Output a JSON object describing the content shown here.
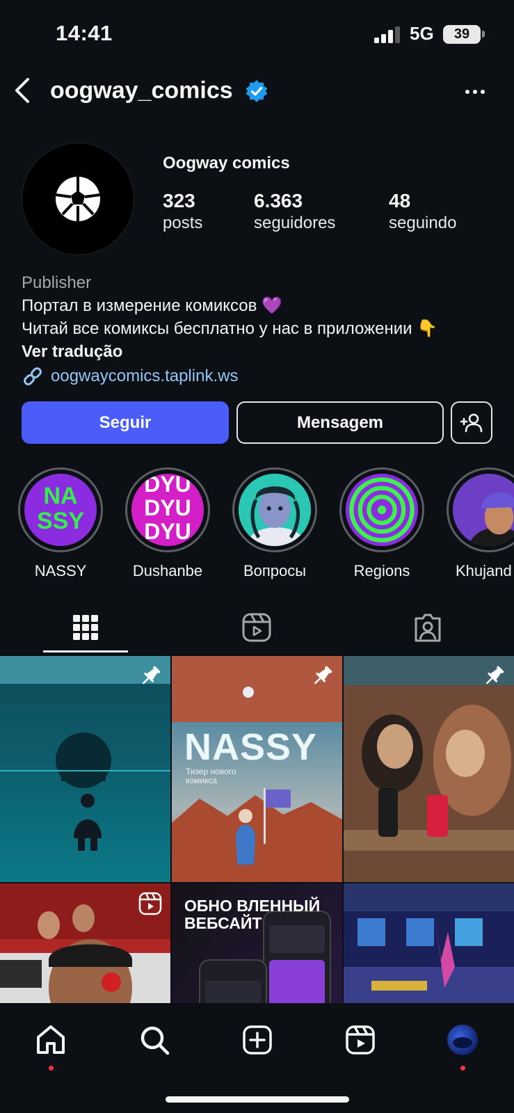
{
  "status_bar": {
    "time": "14:41",
    "network": "5G",
    "battery": "39"
  },
  "header": {
    "username": "oogway_comics"
  },
  "profile": {
    "display_name": "Oogway comics",
    "stats": [
      {
        "value": "323",
        "label": "posts"
      },
      {
        "value": "6.363",
        "label": "seguidores"
      },
      {
        "value": "48",
        "label": "seguindo"
      }
    ],
    "category": "Publisher",
    "bio_lines": [
      "Портал в измерение комиксов 💜",
      "Читай все комиксы бесплатно у нас в приложении 👇"
    ],
    "translate": "Ver tradução",
    "link": "oogwaycomics.taplink.ws"
  },
  "actions": {
    "follow": "Seguir",
    "message": "Mensagem"
  },
  "highlights": [
    {
      "label": "NASSY",
      "art_text": "NA SSY"
    },
    {
      "label": "Dushanbe",
      "art_text": "DYU DYU DYU"
    },
    {
      "label": "Вопросы"
    },
    {
      "label": "Regions"
    },
    {
      "label": "Khujand"
    }
  ],
  "posts": [
    {
      "type": "pinned"
    },
    {
      "type": "pinned",
      "art_title": "NASSY",
      "art_subtitle": "Тизер нового комикса"
    },
    {
      "type": "pinned"
    },
    {
      "type": "reel"
    },
    {
      "type": "image",
      "art_title": "ОБНО ВЛЕННЫЙ ВЕБСАЙТ"
    },
    {
      "type": "image"
    }
  ],
  "colors": {
    "background": "#0c1014",
    "follow_button": "#4a5df9",
    "link": "#93c5f7",
    "verified": "#1d9bf0",
    "notification": "#ff3040"
  }
}
